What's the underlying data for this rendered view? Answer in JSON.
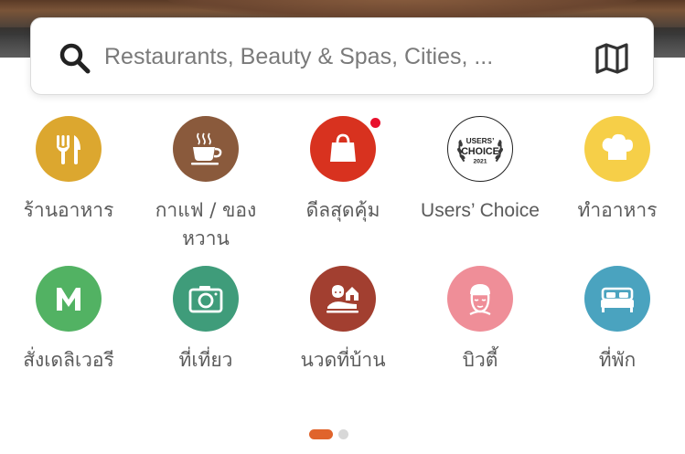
{
  "search": {
    "placeholder": "Restaurants, Beauty & Spas, Cities, ..."
  },
  "categories_row1": [
    {
      "label": "ร้านอาหาร",
      "icon": "fork-knife-icon",
      "color": "#dca72f"
    },
    {
      "label": "กาแฟ / ของหวาน",
      "icon": "coffee-cup-icon",
      "color": "#8a5a3c"
    },
    {
      "label": "ดีลสุดคุ้ม",
      "icon": "shopping-bag-icon",
      "color": "#d8321f"
    },
    {
      "label": "Users’ Choice",
      "icon": "users-choice-badge-icon",
      "color": "#ffffff",
      "badge_title": "USERS’",
      "badge_main": "CHOICE",
      "badge_year": "2021"
    },
    {
      "label": "ทำอาหาร",
      "icon": "chef-hat-icon",
      "color": "#f6cf48"
    }
  ],
  "categories_row2": [
    {
      "label": "สั่งเดลิเวอรี",
      "icon": "delivery-m-icon",
      "color": "#52b263"
    },
    {
      "label": "ที่เที่ยว",
      "icon": "camera-icon",
      "color": "#3f9c7a"
    },
    {
      "label": "นวดที่บ้าน",
      "icon": "home-massage-icon",
      "color": "#a23f30"
    },
    {
      "label": "บิวตี้",
      "icon": "beauty-face-icon",
      "color": "#ef8e98"
    },
    {
      "label": "ที่พัก",
      "icon": "bed-icon",
      "color": "#4aa3bf"
    }
  ],
  "pagination": {
    "pages": 2,
    "current": 1,
    "active_color": "#e0642c"
  }
}
